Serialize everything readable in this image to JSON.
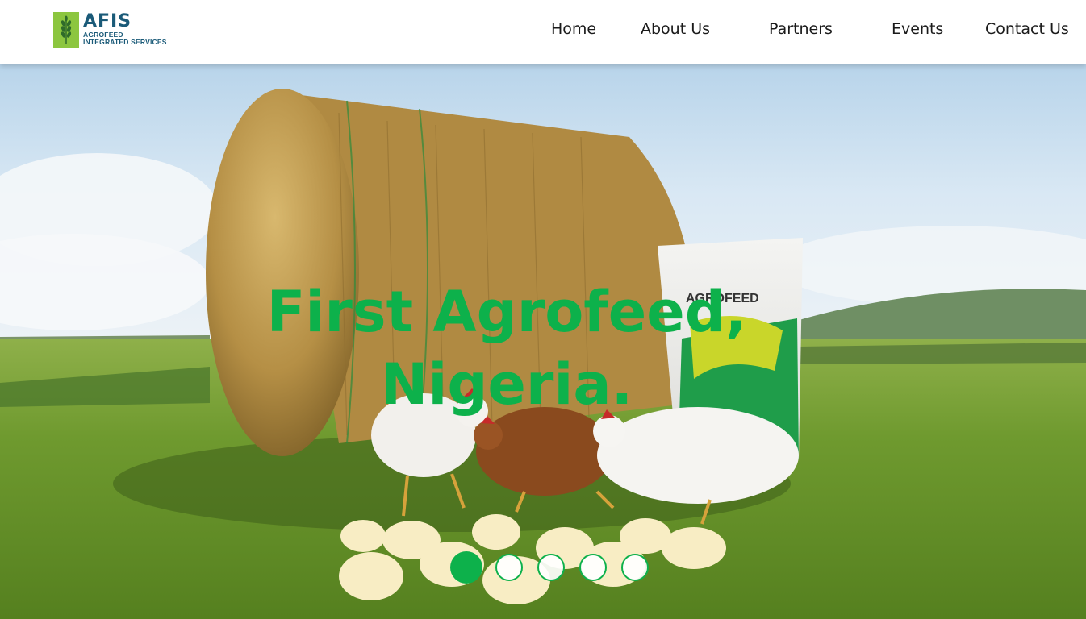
{
  "header": {
    "logo": {
      "name": "AFIS",
      "sub_line_1": "AGROFEED",
      "sub_line_2": "INTEGRATED SERVICES",
      "icon": "wheat-icon",
      "mark_color": "#8cc63f",
      "text_color": "#1a5a78"
    },
    "nav": [
      {
        "label": "Home"
      },
      {
        "label": "About Us"
      },
      {
        "label": "Partners"
      },
      {
        "label": "Events"
      },
      {
        "label": "Contact Us"
      }
    ]
  },
  "hero": {
    "title_line_1": "First Agrofeed,",
    "title_line_2": "Nigeria.",
    "title_color": "#0db14b",
    "bag_label": "AGROFEED",
    "slider": {
      "total_slides": 5,
      "active_index": 0
    }
  }
}
